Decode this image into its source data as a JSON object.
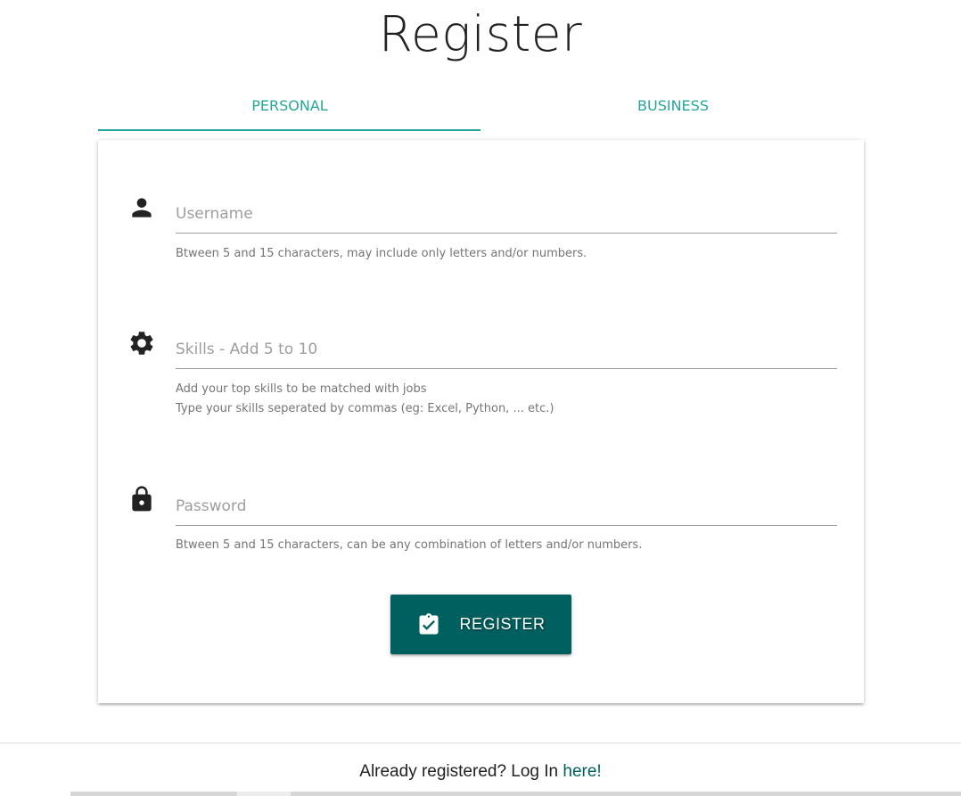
{
  "header": {
    "title": "Register"
  },
  "tabs": [
    {
      "label": "PERSONAL",
      "active": true
    },
    {
      "label": "BUSINESS",
      "active": false
    }
  ],
  "form": {
    "username": {
      "icon": "person-icon",
      "placeholder": "Username",
      "value": "",
      "helper": "Btween 5 and 15 characters, may include only letters and/or numbers."
    },
    "skills": {
      "icon": "gear-icon",
      "placeholder": "Skills - Add 5 to 10",
      "value": "",
      "helper_line1": "Add your top skills to be matched with jobs",
      "helper_line2": "Type your skills seperated by commas (eg: Excel, Python, ... etc.)"
    },
    "password": {
      "icon": "lock-icon",
      "placeholder": "Password",
      "value": "",
      "helper": "Btween 5 and 15 characters, can be any combination of letters and/or numbers."
    },
    "register_button": {
      "icon": "clipboard-check-icon",
      "label": "REGISTER"
    }
  },
  "footer": {
    "prefix": "Already registered? Log In ",
    "link": "here!"
  },
  "colors": {
    "accent": "#26a69a",
    "button": "#00605f",
    "helper_text": "#757575",
    "placeholder": "#9e9e9e"
  }
}
